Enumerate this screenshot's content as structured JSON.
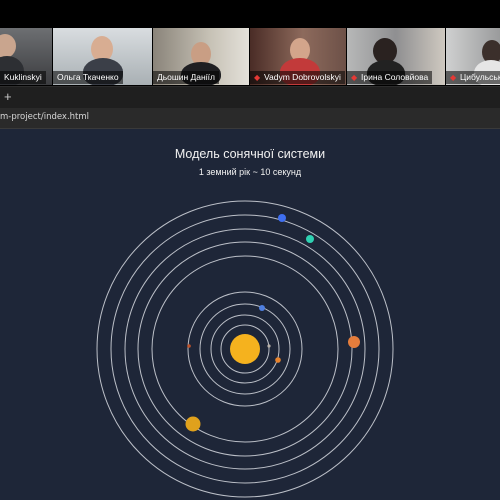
{
  "participants": [
    {
      "name": "Kuklinskyi",
      "muted": false,
      "active": false
    },
    {
      "name": "Ольга Ткаченко",
      "muted": false,
      "active": true
    },
    {
      "name": "Дьошин Даніїл",
      "muted": false,
      "active": false
    },
    {
      "name": "Vadym Dobrovolskyi",
      "muted": true,
      "active": false
    },
    {
      "name": "Ірина Соловйова",
      "muted": true,
      "active": false
    },
    {
      "name": "Цибульськ",
      "muted": true,
      "active": false
    }
  ],
  "browser": {
    "new_tab_symbol": "+",
    "url": "m-project/index.html"
  },
  "page": {
    "title": "Модель сонячної системи",
    "subtitle": "1 земний рік ~ 10 секунд"
  },
  "solar_system": {
    "sun_color": "#f5b21e",
    "orbit_color": "#d8dbe2",
    "planets": [
      {
        "name": "mercury",
        "color": "#b7b0a8"
      },
      {
        "name": "venus",
        "color": "#e8832c"
      },
      {
        "name": "earth",
        "color": "#4f7fe0"
      },
      {
        "name": "mars",
        "color": "#c0532a"
      },
      {
        "name": "jupiter",
        "color": "#e57d3c"
      },
      {
        "name": "saturn",
        "color": "#e0a11c"
      },
      {
        "name": "uranus",
        "color": "#2ed1b2"
      },
      {
        "name": "neptune",
        "color": "#3f6ff0"
      }
    ]
  }
}
